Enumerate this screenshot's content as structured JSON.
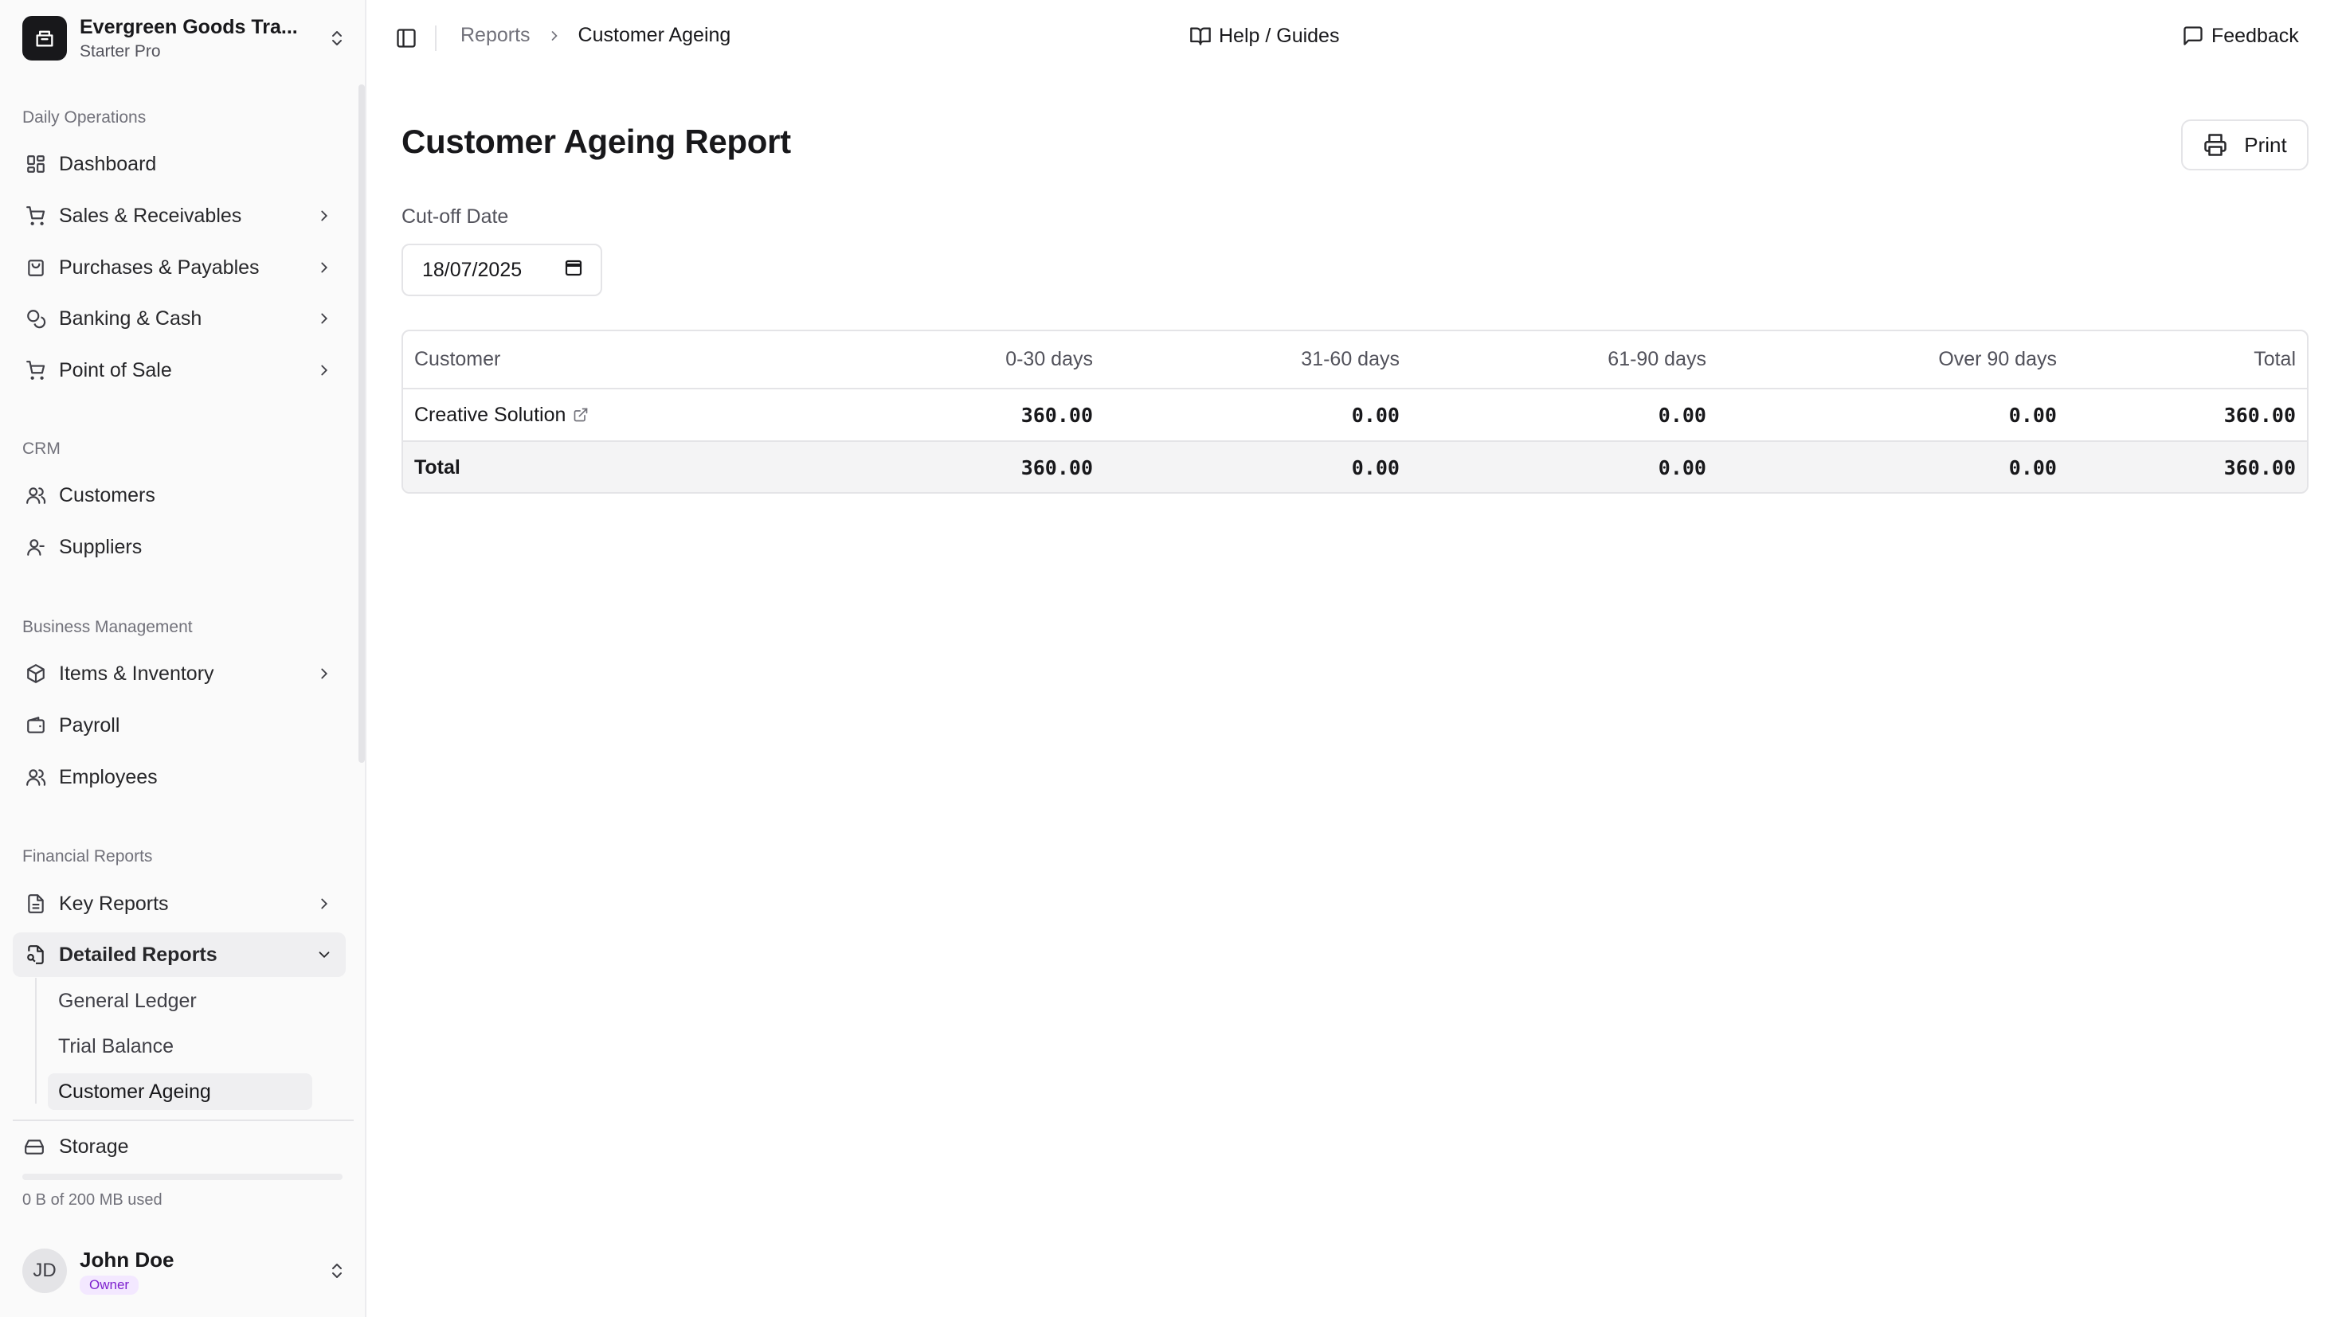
{
  "org": {
    "name": "Evergreen Goods Tra...",
    "plan": "Starter Pro"
  },
  "sidebar": {
    "sections": {
      "daily": "Daily Operations",
      "crm": "CRM",
      "business": "Business Management",
      "financial": "Financial Reports"
    },
    "items": {
      "dashboard": "Dashboard",
      "sales": "Sales & Receivables",
      "purchases": "Purchases & Payables",
      "banking": "Banking & Cash",
      "pos": "Point of Sale",
      "customers": "Customers",
      "suppliers": "Suppliers",
      "items": "Items & Inventory",
      "payroll": "Payroll",
      "employees": "Employees",
      "key_reports": "Key Reports",
      "detailed_reports": "Detailed Reports"
    },
    "sub_items": {
      "general_ledger": "General Ledger",
      "trial_balance": "Trial Balance",
      "customer_ageing": "Customer Ageing"
    },
    "storage": {
      "label": "Storage",
      "usage": "0 B of 200 MB used",
      "used_fraction": 0
    }
  },
  "user": {
    "initials": "JD",
    "name": "John Doe",
    "role": "Owner"
  },
  "header": {
    "breadcrumb_parent": "Reports",
    "breadcrumb_current": "Customer Ageing",
    "help": "Help / Guides",
    "feedback": "Feedback"
  },
  "page": {
    "title": "Customer Ageing Report",
    "print_label": "Print",
    "cutoff_label": "Cut-off Date",
    "cutoff_value": "18/07/2025"
  },
  "table": {
    "columns": [
      "Customer",
      "0-30 days",
      "31-60 days",
      "61-90 days",
      "Over 90 days",
      "Total"
    ],
    "rows": [
      {
        "customer": "Creative Solution",
        "d0_30": "360.00",
        "d31_60": "0.00",
        "d61_90": "0.00",
        "over90": "0.00",
        "total": "360.00"
      }
    ],
    "totals": {
      "label": "Total",
      "d0_30": "360.00",
      "d31_60": "0.00",
      "d61_90": "0.00",
      "over90": "0.00",
      "total": "360.00"
    }
  }
}
